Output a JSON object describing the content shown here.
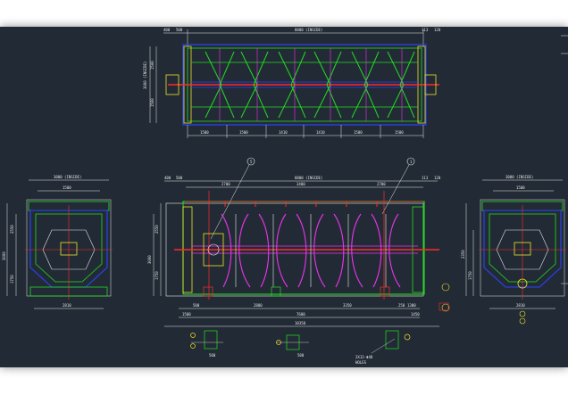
{
  "drawing": {
    "background": "#222b35",
    "colors": {
      "white": "#e8e8e8",
      "green": "#22dd22",
      "blue": "#2a43ff",
      "red": "#ff2a2a",
      "yellow": "#f0e22a"
    },
    "top_view": {
      "overall": "8800 (INSIDE)",
      "left_end": [
        "400",
        "500"
      ],
      "right_end": [
        "113",
        "120"
      ],
      "height_dims": [
        "3000 (INSIDE)",
        "1500",
        "1500"
      ],
      "bottom_dims": [
        "1500",
        "1500",
        "1410",
        "1410",
        "1500",
        "1500"
      ]
    },
    "front_view": {
      "overall": "8800 (INSIDE)",
      "left_end": [
        "400",
        "500"
      ],
      "right_end": [
        "113",
        "120"
      ],
      "top_dims": [
        "2700",
        "3400",
        "2700"
      ],
      "height_dims": [
        "3000",
        "2550",
        "1750"
      ],
      "bottom_dims": [
        "500",
        "2800",
        "3350"
      ],
      "bottom_total": "7600",
      "bottom_left": "1500",
      "overall_bottom": "10350",
      "right_small": [
        "250",
        "1300",
        "1450"
      ],
      "callouts": [
        "5",
        "1"
      ],
      "note_lines": [
        "2X12-Φ48",
        "HOLES"
      ]
    },
    "left_view": {
      "width_top": "3000 (INSIDE)",
      "width_inner": "1500",
      "height_dims": [
        "3000",
        "2550",
        "1750"
      ],
      "bottom": "2810"
    },
    "right_view": {
      "width_top": "3000 (INSIDE)",
      "width_inner": "1500",
      "height_dims": [
        "2350",
        "1750"
      ],
      "bottom": "2810"
    },
    "foundation": {
      "dims": [
        "500",
        "500"
      ]
    }
  }
}
